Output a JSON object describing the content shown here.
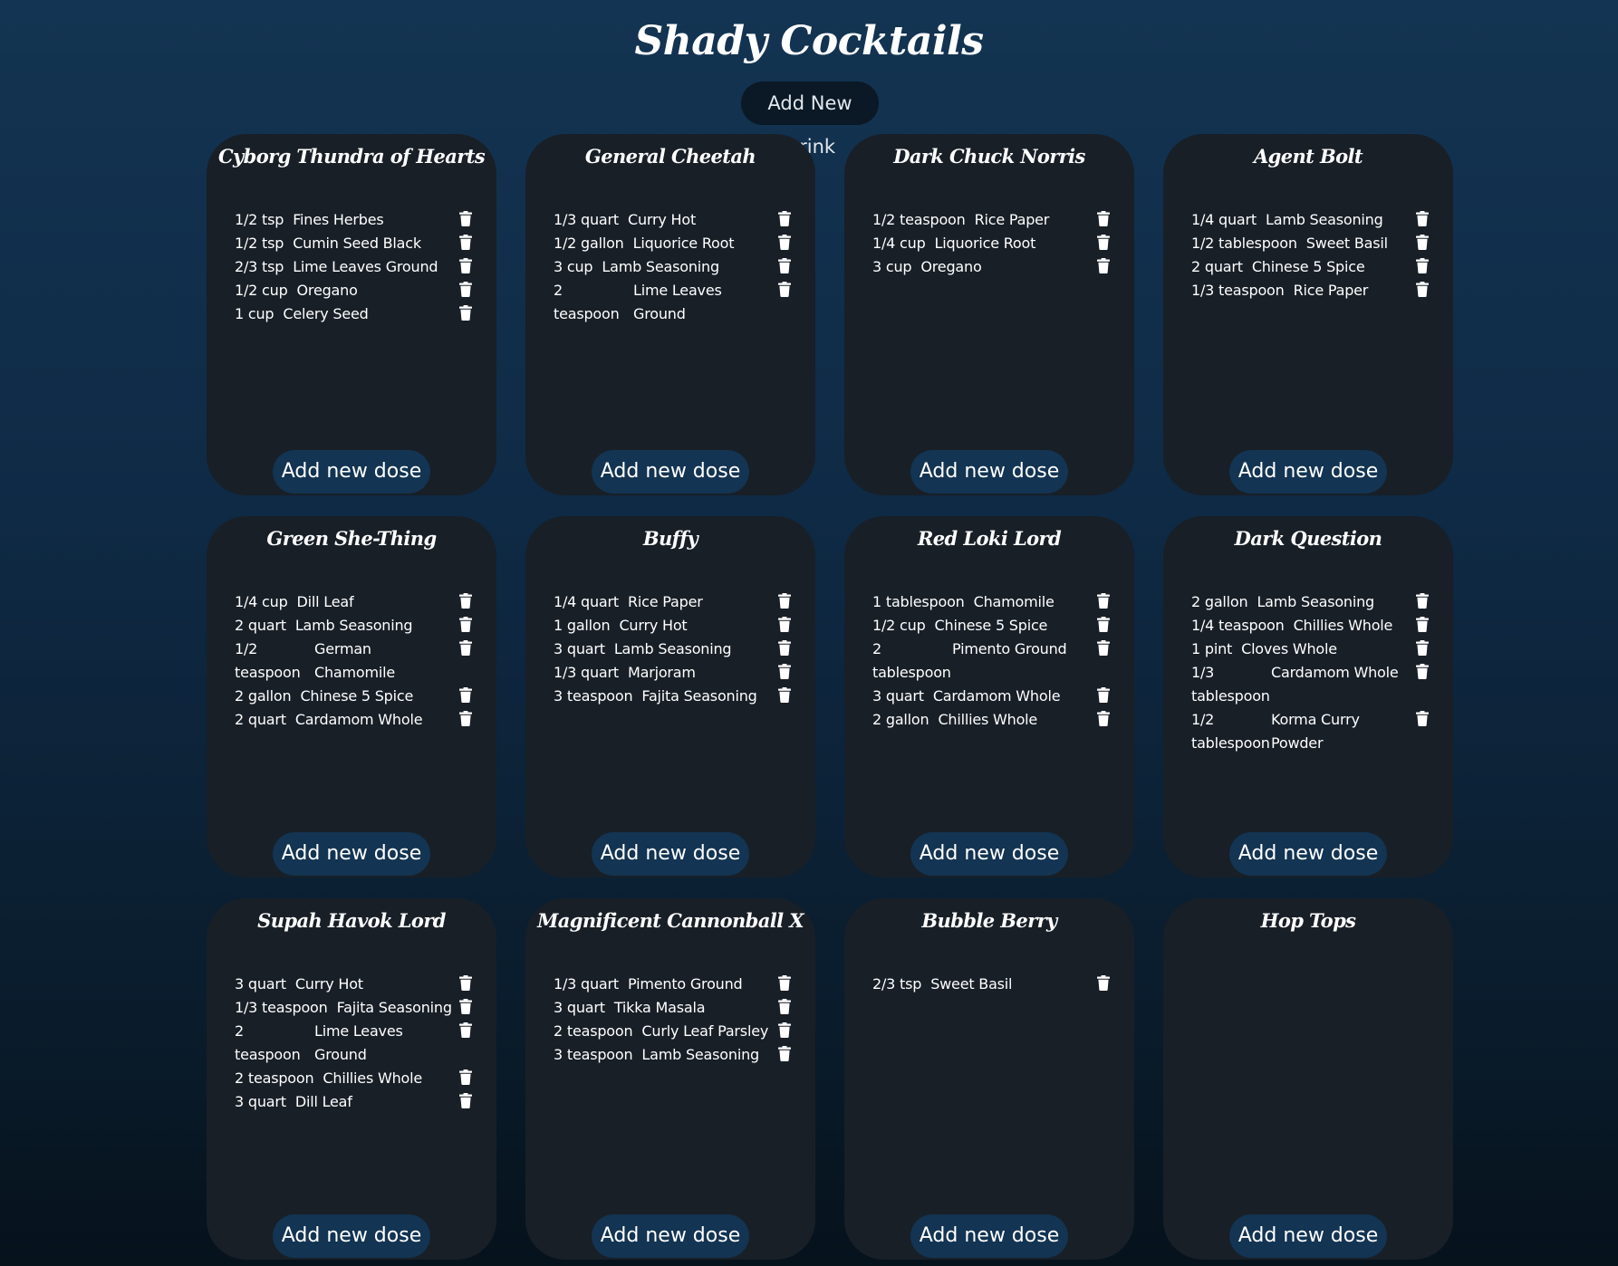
{
  "app": {
    "title": "Shady Cocktails",
    "add_drink_label": "Add New Drink",
    "add_dose_label": "Add new dose"
  },
  "colors": {
    "background_top": "#133452",
    "background_bottom": "#06121c",
    "card": "#181f27",
    "add_dose_button": "#133452",
    "add_drink_button": "#0b1826"
  },
  "icons": {
    "remove_dose": "trash-icon"
  },
  "drinks": [
    {
      "name": "Cyborg Thundra of Hearts",
      "doses": [
        {
          "amount": "1/2 tsp",
          "ingredient": "Fines Herbes"
        },
        {
          "amount": "1/2 tsp",
          "ingredient": "Cumin Seed Black"
        },
        {
          "amount": "2/3 tsp",
          "ingredient": "Lime Leaves Ground"
        },
        {
          "amount": "1/2 cup",
          "ingredient": "Oregano"
        },
        {
          "amount": "1 cup",
          "ingredient": "Celery Seed"
        }
      ]
    },
    {
      "name": "General Cheetah",
      "doses": [
        {
          "amount": "1/3 quart",
          "ingredient": "Curry Hot"
        },
        {
          "amount": "1/2 gallon",
          "ingredient": "Liquorice Root"
        },
        {
          "amount": "3 cup",
          "ingredient": "Lamb Seasoning"
        },
        {
          "amount": "2 teaspoon",
          "ingredient": "Lime Leaves Ground",
          "wrap": true
        }
      ]
    },
    {
      "name": "Dark Chuck Norris",
      "doses": [
        {
          "amount": "1/2 teaspoon",
          "ingredient": "Rice Paper"
        },
        {
          "amount": "1/4 cup",
          "ingredient": "Liquorice Root"
        },
        {
          "amount": "3 cup",
          "ingredient": "Oregano"
        }
      ]
    },
    {
      "name": "Agent Bolt",
      "doses": [
        {
          "amount": "1/4 quart",
          "ingredient": "Lamb Seasoning"
        },
        {
          "amount": "1/2 tablespoon",
          "ingredient": "Sweet Basil"
        },
        {
          "amount": "2 quart",
          "ingredient": "Chinese 5 Spice"
        },
        {
          "amount": "1/3 teaspoon",
          "ingredient": "Rice Paper"
        }
      ]
    },
    {
      "name": "Green She-Thing",
      "doses": [
        {
          "amount": "1/4 cup",
          "ingredient": "Dill Leaf"
        },
        {
          "amount": "2 quart",
          "ingredient": "Lamb Seasoning"
        },
        {
          "amount": "1/2 teaspoon",
          "ingredient": "German Chamomile",
          "wrap": true
        },
        {
          "amount": "2 gallon",
          "ingredient": "Chinese 5 Spice"
        },
        {
          "amount": "2 quart",
          "ingredient": "Cardamom Whole"
        }
      ]
    },
    {
      "name": "Buffy",
      "doses": [
        {
          "amount": "1/4 quart",
          "ingredient": "Rice Paper"
        },
        {
          "amount": "1 gallon",
          "ingredient": "Curry Hot"
        },
        {
          "amount": "3 quart",
          "ingredient": "Lamb Seasoning"
        },
        {
          "amount": "1/3 quart",
          "ingredient": "Marjoram"
        },
        {
          "amount": "3 teaspoon",
          "ingredient": "Fajita Seasoning"
        }
      ]
    },
    {
      "name": "Red Loki Lord",
      "doses": [
        {
          "amount": "1 tablespoon",
          "ingredient": "Chamomile"
        },
        {
          "amount": "1/2 cup",
          "ingredient": "Chinese 5 Spice"
        },
        {
          "amount": "2 tablespoon",
          "ingredient": "Pimento Ground",
          "wrap": true
        },
        {
          "amount": "3 quart",
          "ingredient": "Cardamom Whole"
        },
        {
          "amount": "2 gallon",
          "ingredient": "Chillies Whole"
        }
      ]
    },
    {
      "name": "Dark Question",
      "doses": [
        {
          "amount": "2 gallon",
          "ingredient": "Lamb Seasoning"
        },
        {
          "amount": "1/4 teaspoon",
          "ingredient": "Chillies Whole"
        },
        {
          "amount": "1 pint",
          "ingredient": "Cloves Whole"
        },
        {
          "amount": "1/3 tablespoon",
          "ingredient": "Cardamom Whole",
          "wrap": true
        },
        {
          "amount": "1/2 tablespoon",
          "ingredient": "Korma Curry Powder",
          "wrap": true
        }
      ]
    },
    {
      "name": "Supah Havok Lord",
      "doses": [
        {
          "amount": "3 quart",
          "ingredient": "Curry Hot"
        },
        {
          "amount": "1/3 teaspoon",
          "ingredient": "Fajita Seasoning"
        },
        {
          "amount": "2 teaspoon",
          "ingredient": "Lime Leaves Ground",
          "wrap": true
        },
        {
          "amount": "2 teaspoon",
          "ingredient": "Chillies Whole"
        },
        {
          "amount": "3 quart",
          "ingredient": "Dill Leaf"
        }
      ]
    },
    {
      "name": "Magnificent Cannonball X",
      "doses": [
        {
          "amount": "1/3 quart",
          "ingredient": "Pimento Ground"
        },
        {
          "amount": "3 quart",
          "ingredient": "Tikka Masala"
        },
        {
          "amount": "2 teaspoon",
          "ingredient": "Curly Leaf Parsley"
        },
        {
          "amount": "3 teaspoon",
          "ingredient": "Lamb Seasoning"
        }
      ]
    },
    {
      "name": "Bubble Berry",
      "doses": [
        {
          "amount": "2/3 tsp",
          "ingredient": "Sweet Basil"
        }
      ]
    },
    {
      "name": "Hop Tops",
      "doses": []
    }
  ]
}
